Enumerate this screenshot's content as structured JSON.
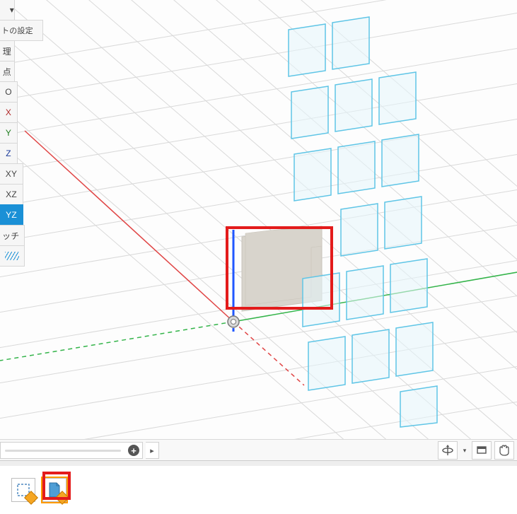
{
  "sidePanel": {
    "items": [
      {
        "label": "▾",
        "name": "dropdown-toggle",
        "kind": "dd"
      },
      {
        "label": "トの設定",
        "name": "settings-button",
        "kind": "first"
      },
      {
        "label": "理",
        "name": "tool-management",
        "kind": "narrow"
      },
      {
        "label": "点",
        "name": "tool-point",
        "kind": "narrow"
      },
      {
        "label": "O",
        "name": "origin-button",
        "kind": "letter"
      },
      {
        "label": "X",
        "name": "x-axis-button",
        "kind": "letter",
        "cls": "x-label"
      },
      {
        "label": "Y",
        "name": "y-axis-button",
        "kind": "letter",
        "cls": "y-label"
      },
      {
        "label": "Z",
        "name": "z-axis-button",
        "kind": "letter",
        "cls": "z-label"
      },
      {
        "label": "XY",
        "name": "xy-plane-button",
        "kind": "letter"
      },
      {
        "label": "XZ",
        "name": "xz-plane-button",
        "kind": "letter"
      },
      {
        "label": "YZ",
        "name": "yz-plane-button",
        "kind": "letter",
        "active": true
      },
      {
        "label": "ッチ",
        "name": "hatch-button",
        "kind": "hatch"
      }
    ]
  },
  "bottom": {
    "slider_plus": "+",
    "slider_open": "▸",
    "nav": {
      "orbit": "orbit-icon",
      "orbit_dd": "▾",
      "look": "look-at-icon",
      "pan": "pan-icon"
    }
  },
  "tabs": {
    "items": [
      {
        "name": "drawing-thumb-sketch",
        "active": false
      },
      {
        "name": "drawing-thumb-page",
        "active": true
      }
    ]
  },
  "colors": {
    "axis_x": "#e04545",
    "axis_y": "#34b44a",
    "axis_z": "#2056ff",
    "grid": "#d9d9d9",
    "pattern_stroke": "#5fc5e6",
    "pattern_fill": "#e6f6fc",
    "body_fill": "#d8d4cc",
    "highlight": "#e31b1b"
  }
}
